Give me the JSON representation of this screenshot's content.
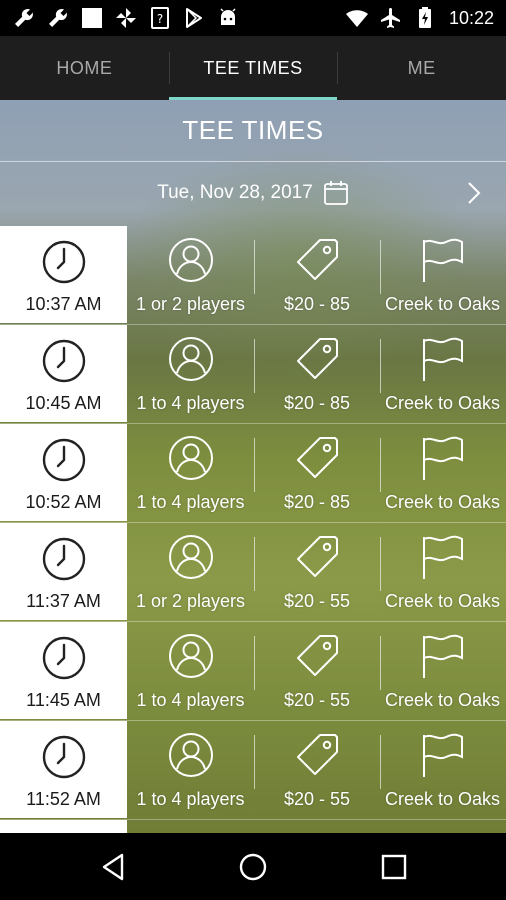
{
  "status_bar": {
    "time": "10:22",
    "left_icons": [
      "wrench-icon",
      "wrench-icon",
      "square-icon",
      "pinwheel-icon",
      "question-box-icon",
      "play-store-icon",
      "android-icon"
    ],
    "right_icons": [
      "wifi-icon",
      "airplane-icon",
      "battery-charging-icon"
    ]
  },
  "tabs": [
    {
      "label": "HOME",
      "active": false
    },
    {
      "label": "TEE TIMES",
      "active": true
    },
    {
      "label": "ME",
      "active": false
    }
  ],
  "page": {
    "title": "TEE TIMES",
    "date": "Tue, Nov 28, 2017"
  },
  "tee_times": [
    {
      "time": "10:37 AM",
      "players": "1 or 2 players",
      "price": "$20 - 85",
      "course": "Creek to Oaks"
    },
    {
      "time": "10:45 AM",
      "players": "1 to 4 players",
      "price": "$20 - 85",
      "course": "Creek to Oaks"
    },
    {
      "time": "10:52 AM",
      "players": "1 to 4 players",
      "price": "$20 - 85",
      "course": "Creek to Oaks"
    },
    {
      "time": "11:37 AM",
      "players": "1 or 2 players",
      "price": "$20 - 55",
      "course": "Creek to Oaks"
    },
    {
      "time": "11:45 AM",
      "players": "1 to 4 players",
      "price": "$20 - 55",
      "course": "Creek to Oaks"
    },
    {
      "time": "11:52 AM",
      "players": "1 to 4 players",
      "price": "$20 - 55",
      "course": "Creek to Oaks"
    }
  ],
  "colors": {
    "tab_bar": "#1e1e1e",
    "tab_indicator": "#7ed6c8",
    "time_box": "#ffffff"
  }
}
